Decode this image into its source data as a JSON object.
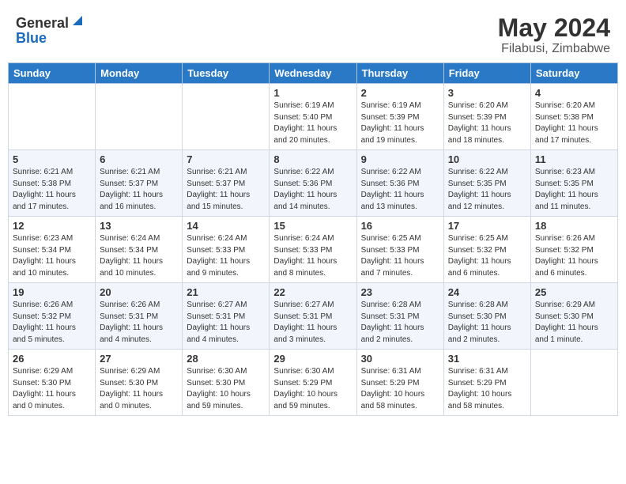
{
  "header": {
    "logo_general": "General",
    "logo_blue": "Blue",
    "month": "May 2024",
    "location": "Filabusi, Zimbabwe"
  },
  "weekdays": [
    "Sunday",
    "Monday",
    "Tuesday",
    "Wednesday",
    "Thursday",
    "Friday",
    "Saturday"
  ],
  "weeks": [
    [
      {
        "day": "",
        "info": ""
      },
      {
        "day": "",
        "info": ""
      },
      {
        "day": "",
        "info": ""
      },
      {
        "day": "1",
        "info": "Sunrise: 6:19 AM\nSunset: 5:40 PM\nDaylight: 11 hours\nand 20 minutes."
      },
      {
        "day": "2",
        "info": "Sunrise: 6:19 AM\nSunset: 5:39 PM\nDaylight: 11 hours\nand 19 minutes."
      },
      {
        "day": "3",
        "info": "Sunrise: 6:20 AM\nSunset: 5:39 PM\nDaylight: 11 hours\nand 18 minutes."
      },
      {
        "day": "4",
        "info": "Sunrise: 6:20 AM\nSunset: 5:38 PM\nDaylight: 11 hours\nand 17 minutes."
      }
    ],
    [
      {
        "day": "5",
        "info": "Sunrise: 6:21 AM\nSunset: 5:38 PM\nDaylight: 11 hours\nand 17 minutes."
      },
      {
        "day": "6",
        "info": "Sunrise: 6:21 AM\nSunset: 5:37 PM\nDaylight: 11 hours\nand 16 minutes."
      },
      {
        "day": "7",
        "info": "Sunrise: 6:21 AM\nSunset: 5:37 PM\nDaylight: 11 hours\nand 15 minutes."
      },
      {
        "day": "8",
        "info": "Sunrise: 6:22 AM\nSunset: 5:36 PM\nDaylight: 11 hours\nand 14 minutes."
      },
      {
        "day": "9",
        "info": "Sunrise: 6:22 AM\nSunset: 5:36 PM\nDaylight: 11 hours\nand 13 minutes."
      },
      {
        "day": "10",
        "info": "Sunrise: 6:22 AM\nSunset: 5:35 PM\nDaylight: 11 hours\nand 12 minutes."
      },
      {
        "day": "11",
        "info": "Sunrise: 6:23 AM\nSunset: 5:35 PM\nDaylight: 11 hours\nand 11 minutes."
      }
    ],
    [
      {
        "day": "12",
        "info": "Sunrise: 6:23 AM\nSunset: 5:34 PM\nDaylight: 11 hours\nand 10 minutes."
      },
      {
        "day": "13",
        "info": "Sunrise: 6:24 AM\nSunset: 5:34 PM\nDaylight: 11 hours\nand 10 minutes."
      },
      {
        "day": "14",
        "info": "Sunrise: 6:24 AM\nSunset: 5:33 PM\nDaylight: 11 hours\nand 9 minutes."
      },
      {
        "day": "15",
        "info": "Sunrise: 6:24 AM\nSunset: 5:33 PM\nDaylight: 11 hours\nand 8 minutes."
      },
      {
        "day": "16",
        "info": "Sunrise: 6:25 AM\nSunset: 5:33 PM\nDaylight: 11 hours\nand 7 minutes."
      },
      {
        "day": "17",
        "info": "Sunrise: 6:25 AM\nSunset: 5:32 PM\nDaylight: 11 hours\nand 6 minutes."
      },
      {
        "day": "18",
        "info": "Sunrise: 6:26 AM\nSunset: 5:32 PM\nDaylight: 11 hours\nand 6 minutes."
      }
    ],
    [
      {
        "day": "19",
        "info": "Sunrise: 6:26 AM\nSunset: 5:32 PM\nDaylight: 11 hours\nand 5 minutes."
      },
      {
        "day": "20",
        "info": "Sunrise: 6:26 AM\nSunset: 5:31 PM\nDaylight: 11 hours\nand 4 minutes."
      },
      {
        "day": "21",
        "info": "Sunrise: 6:27 AM\nSunset: 5:31 PM\nDaylight: 11 hours\nand 4 minutes."
      },
      {
        "day": "22",
        "info": "Sunrise: 6:27 AM\nSunset: 5:31 PM\nDaylight: 11 hours\nand 3 minutes."
      },
      {
        "day": "23",
        "info": "Sunrise: 6:28 AM\nSunset: 5:31 PM\nDaylight: 11 hours\nand 2 minutes."
      },
      {
        "day": "24",
        "info": "Sunrise: 6:28 AM\nSunset: 5:30 PM\nDaylight: 11 hours\nand 2 minutes."
      },
      {
        "day": "25",
        "info": "Sunrise: 6:29 AM\nSunset: 5:30 PM\nDaylight: 11 hours\nand 1 minute."
      }
    ],
    [
      {
        "day": "26",
        "info": "Sunrise: 6:29 AM\nSunset: 5:30 PM\nDaylight: 11 hours\nand 0 minutes."
      },
      {
        "day": "27",
        "info": "Sunrise: 6:29 AM\nSunset: 5:30 PM\nDaylight: 11 hours\nand 0 minutes."
      },
      {
        "day": "28",
        "info": "Sunrise: 6:30 AM\nSunset: 5:30 PM\nDaylight: 10 hours\nand 59 minutes."
      },
      {
        "day": "29",
        "info": "Sunrise: 6:30 AM\nSunset: 5:29 PM\nDaylight: 10 hours\nand 59 minutes."
      },
      {
        "day": "30",
        "info": "Sunrise: 6:31 AM\nSunset: 5:29 PM\nDaylight: 10 hours\nand 58 minutes."
      },
      {
        "day": "31",
        "info": "Sunrise: 6:31 AM\nSunset: 5:29 PM\nDaylight: 10 hours\nand 58 minutes."
      },
      {
        "day": "",
        "info": ""
      }
    ]
  ]
}
